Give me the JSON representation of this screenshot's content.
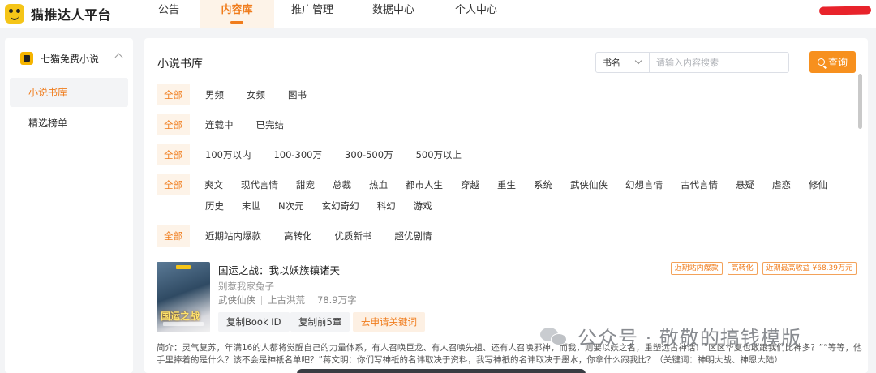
{
  "app": {
    "brand": "猫推达人平台"
  },
  "nav": {
    "items": [
      "公告",
      "内容库",
      "推广管理",
      "数据中心",
      "个人中心"
    ],
    "active": "内容库"
  },
  "sidebar": {
    "group_label": "七猫免费小说",
    "items": [
      "小说书库",
      "精选榜单"
    ],
    "active": "小说书库"
  },
  "main": {
    "title": "小说书库",
    "search": {
      "type_label": "书名",
      "placeholder": "请输入内容搜索",
      "button_label": "查询"
    },
    "filters": {
      "channel": [
        "全部",
        "男频",
        "女频",
        "图书"
      ],
      "status": [
        "全部",
        "连载中",
        "已完结"
      ],
      "word_count": [
        "全部",
        "100万以内",
        "100-300万",
        "300-500万",
        "500万以上"
      ],
      "genre": [
        "全部",
        "爽文",
        "现代言情",
        "甜宠",
        "总裁",
        "热血",
        "都市人生",
        "穿越",
        "重生",
        "系统",
        "武侠仙侠",
        "幻想言情",
        "古代言情",
        "悬疑",
        "虐恋",
        "修仙",
        "历史",
        "末世",
        "N次元",
        "玄幻奇幻",
        "科幻",
        "游戏"
      ],
      "recommend": [
        "全部",
        "近期站内爆款",
        "高转化",
        "优质新书",
        "超优剧情"
      ]
    }
  },
  "book": {
    "title": "国运之战：我以妖族镇诸天",
    "author": "别惹我家兔子",
    "category": "武侠仙侠",
    "subcategory": "上古洪荒",
    "word_count": "78.9万字",
    "cover_text": "国运之战",
    "tags": [
      "近期站内爆款",
      "高转化",
      "近期最高收益 ¥68.39万元"
    ],
    "buttons": {
      "copy_id": "复制Book ID",
      "copy_chapters": "复制前5章",
      "apply_keyword": "去申请关键词"
    },
    "intro": "简介：灵气复苏，年满16的人都将觉醒自己的力量体系，有人召唤巨龙、有人召唤先祖、还有人召唤邪神，而我，则要以妖之名，重塑远古神话！“区区华夏也敢跟我们比神多？”“等等，他手里捧着的是什么？该不会是神祇名单吧？”蒋文明：你们写神祇的名讳取决于资料，我写神祇的名讳取决于墨水，你拿什么跟我比？（关键词：神明大战、神恩大陆）"
  },
  "watermark": {
    "text": "公众号 · 敬敬的搞钱模版"
  }
}
